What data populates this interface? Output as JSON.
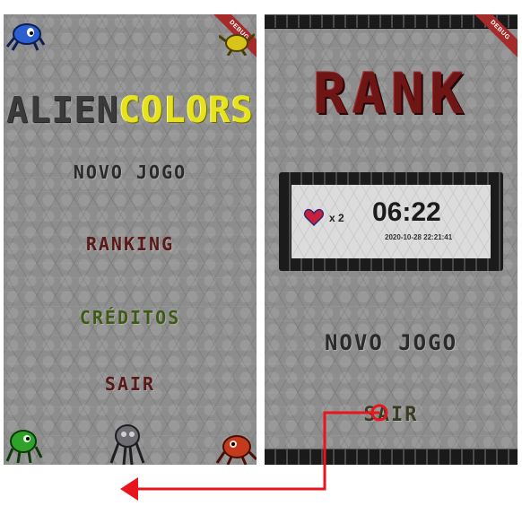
{
  "left_screen": {
    "debug_banner": "DEBUG",
    "logo": {
      "part1": "ALIEN",
      "part2": "COLORS"
    },
    "menu": {
      "new_game": "NOVO JOGO",
      "ranking": "RANKING",
      "credits": "CRÉDITOS",
      "exit": "SAIR"
    },
    "aliens": [
      "blue-alien-icon",
      "yellow-alien-icon",
      "green-alien-icon",
      "gray-alien-icon",
      "red-alien-icon"
    ]
  },
  "right_screen": {
    "debug_banner": "DEBUG",
    "title": "RANK",
    "score": {
      "lives": "x 2",
      "time": "06:22",
      "date": "2020-10-28 22:21:41"
    },
    "menu": {
      "new_game": "NOVO JOGO",
      "exit": "SAIR"
    }
  },
  "colors": {
    "menu_new_game": "#2a2a2a",
    "menu_ranking": "#5a1818",
    "menu_credits": "#3f5a16",
    "menu_exit": "#5a1818",
    "rank_title": "#6e1616",
    "logo_colors": "#e6e21e",
    "annotation_arrow": "#e8141e"
  }
}
